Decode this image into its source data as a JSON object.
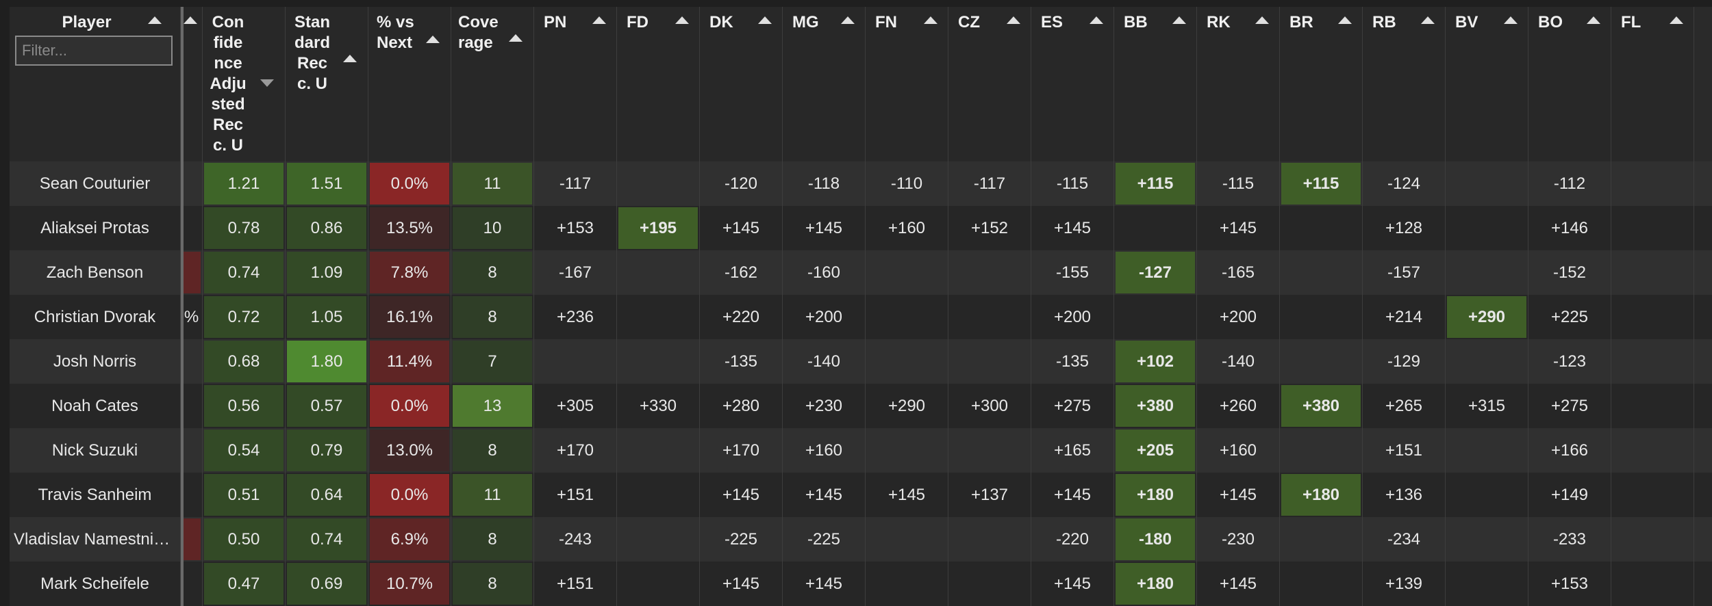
{
  "colors": {
    "best_odds": "#3f5e27",
    "coverage_high": "#4f7a2f",
    "coverage_mid": "#3b5428",
    "coverage_low": "#2f3e27",
    "red_strong": "#8a2626",
    "red_mid": "#5f2525",
    "red_low": "#3e2626",
    "green_strong": "#4f8a30",
    "green_mid": "#3e6528",
    "green_low": "#334a26"
  },
  "filter": {
    "placeholder": "Filter..."
  },
  "columns": [
    {
      "key": "player",
      "label": "Player",
      "sort": "up"
    },
    {
      "key": "edge",
      "label": "",
      "sort": "up"
    },
    {
      "key": "conf",
      "label": "Confidence Adjusted Recc. U",
      "sort": "down"
    },
    {
      "key": "std",
      "label": "Standard Recc. U",
      "sort": "up"
    },
    {
      "key": "pct",
      "label": "% vs Next",
      "sort": "up"
    },
    {
      "key": "cov",
      "label": "Coverage",
      "sort": "up"
    },
    {
      "key": "PN",
      "label": "PN",
      "sort": "up"
    },
    {
      "key": "FD",
      "label": "FD",
      "sort": "up"
    },
    {
      "key": "DK",
      "label": "DK",
      "sort": "up"
    },
    {
      "key": "MG",
      "label": "MG",
      "sort": "up"
    },
    {
      "key": "FN",
      "label": "FN",
      "sort": "up"
    },
    {
      "key": "CZ",
      "label": "CZ",
      "sort": "up"
    },
    {
      "key": "ES",
      "label": "ES",
      "sort": "up"
    },
    {
      "key": "BB",
      "label": "BB",
      "sort": "up"
    },
    {
      "key": "RK",
      "label": "RK",
      "sort": "up"
    },
    {
      "key": "BR",
      "label": "BR",
      "sort": "up"
    },
    {
      "key": "RB",
      "label": "RB",
      "sort": "up"
    },
    {
      "key": "BV",
      "label": "BV",
      "sort": "up"
    },
    {
      "key": "BO",
      "label": "BO",
      "sort": "up"
    },
    {
      "key": "FL",
      "label": "FL",
      "sort": "up"
    }
  ],
  "rows": [
    {
      "player": "Sean Couturier",
      "edge": "",
      "conf": "1.21",
      "std": "1.51",
      "pct": "0.0%",
      "cov": "11",
      "PN": "-117",
      "FD": "",
      "DK": "-120",
      "MG": "-118",
      "FN": "-110",
      "CZ": "-117",
      "ES": "-115",
      "BB": "+115",
      "RK": "-115",
      "BR": "+115",
      "RB": "-124",
      "BV": "",
      "BO": "-112",
      "FL": "",
      "best": [
        "BB",
        "BR"
      ],
      "conf_level": "mid",
      "std_level": "mid",
      "pct_level": "strong",
      "cov_level": "mid"
    },
    {
      "player": "Aliaksei Protas",
      "edge": "",
      "conf": "0.78",
      "std": "0.86",
      "pct": "13.5%",
      "cov": "10",
      "PN": "+153",
      "FD": "+195",
      "DK": "+145",
      "MG": "+145",
      "FN": "+160",
      "CZ": "+152",
      "ES": "+145",
      "BB": "",
      "RK": "+145",
      "BR": "",
      "RB": "+128",
      "BV": "",
      "BO": "+146",
      "FL": "",
      "best": [
        "FD"
      ],
      "conf_level": "low",
      "std_level": "low",
      "pct_level": "low",
      "cov_level": "low"
    },
    {
      "player": "Zach Benson",
      "edge": "",
      "conf": "0.74",
      "std": "1.09",
      "pct": "7.8%",
      "cov": "8",
      "PN": "-167",
      "FD": "",
      "DK": "-162",
      "MG": "-160",
      "FN": "",
      "CZ": "",
      "ES": "-155",
      "BB": "-127",
      "RK": "-165",
      "BR": "",
      "RB": "-157",
      "BV": "",
      "BO": "-152",
      "FL": "",
      "best": [
        "BB"
      ],
      "conf_level": "low",
      "std_level": "low",
      "pct_level": "mid",
      "cov_level": "low"
    },
    {
      "player": "Christian Dvorak",
      "edge": "%",
      "conf": "0.72",
      "std": "1.05",
      "pct": "16.1%",
      "cov": "8",
      "PN": "+236",
      "FD": "",
      "DK": "+220",
      "MG": "+200",
      "FN": "",
      "CZ": "",
      "ES": "+200",
      "BB": "",
      "RK": "+200",
      "BR": "",
      "RB": "+214",
      "BV": "+290",
      "BO": "+225",
      "FL": "",
      "best": [
        "BV"
      ],
      "conf_level": "low",
      "std_level": "low",
      "pct_level": "low",
      "cov_level": "low"
    },
    {
      "player": "Josh Norris",
      "edge": "",
      "conf": "0.68",
      "std": "1.80",
      "pct": "11.4%",
      "cov": "7",
      "PN": "",
      "FD": "",
      "DK": "-135",
      "MG": "-140",
      "FN": "",
      "CZ": "",
      "ES": "-135",
      "BB": "+102",
      "RK": "-140",
      "BR": "",
      "RB": "-129",
      "BV": "",
      "BO": "-123",
      "FL": "",
      "best": [
        "BB"
      ],
      "conf_level": "low",
      "std_level": "strong",
      "pct_level": "mid",
      "cov_level": "low"
    },
    {
      "player": "Noah Cates",
      "edge": "",
      "conf": "0.56",
      "std": "0.57",
      "pct": "0.0%",
      "cov": "13",
      "PN": "+305",
      "FD": "+330",
      "DK": "+280",
      "MG": "+230",
      "FN": "+290",
      "CZ": "+300",
      "ES": "+275",
      "BB": "+380",
      "RK": "+260",
      "BR": "+380",
      "RB": "+265",
      "BV": "+315",
      "BO": "+275",
      "FL": "",
      "best": [
        "BB",
        "BR"
      ],
      "conf_level": "low",
      "std_level": "low",
      "pct_level": "strong",
      "cov_level": "high"
    },
    {
      "player": "Nick Suzuki",
      "edge": "",
      "conf": "0.54",
      "std": "0.79",
      "pct": "13.0%",
      "cov": "8",
      "PN": "+170",
      "FD": "",
      "DK": "+170",
      "MG": "+160",
      "FN": "",
      "CZ": "",
      "ES": "+165",
      "BB": "+205",
      "RK": "+160",
      "BR": "",
      "RB": "+151",
      "BV": "",
      "BO": "+166",
      "FL": "",
      "best": [
        "BB"
      ],
      "conf_level": "low",
      "std_level": "low",
      "pct_level": "low",
      "cov_level": "low"
    },
    {
      "player": "Travis Sanheim",
      "edge": "",
      "conf": "0.51",
      "std": "0.64",
      "pct": "0.0%",
      "cov": "11",
      "PN": "+151",
      "FD": "",
      "DK": "+145",
      "MG": "+145",
      "FN": "+145",
      "CZ": "+137",
      "ES": "+145",
      "BB": "+180",
      "RK": "+145",
      "BR": "+180",
      "RB": "+136",
      "BV": "",
      "BO": "+149",
      "FL": "",
      "best": [
        "BB",
        "BR"
      ],
      "conf_level": "low",
      "std_level": "low",
      "pct_level": "strong",
      "cov_level": "mid"
    },
    {
      "player": "Vladislav Namestnikov",
      "edge": "",
      "conf": "0.50",
      "std": "0.74",
      "pct": "6.9%",
      "cov": "8",
      "PN": "-243",
      "FD": "",
      "DK": "-225",
      "MG": "-225",
      "FN": "",
      "CZ": "",
      "ES": "-220",
      "BB": "-180",
      "RK": "-230",
      "BR": "",
      "RB": "-234",
      "BV": "",
      "BO": "-233",
      "FL": "",
      "best": [
        "BB"
      ],
      "conf_level": "low",
      "std_level": "low",
      "pct_level": "mid",
      "cov_level": "low"
    },
    {
      "player": "Mark Scheifele",
      "edge": "",
      "conf": "0.47",
      "std": "0.69",
      "pct": "10.7%",
      "cov": "8",
      "PN": "+151",
      "FD": "",
      "DK": "+145",
      "MG": "+145",
      "FN": "",
      "CZ": "",
      "ES": "+145",
      "BB": "+180",
      "RK": "+145",
      "BR": "",
      "RB": "+139",
      "BV": "",
      "BO": "+153",
      "FL": "",
      "best": [
        "BB"
      ],
      "conf_level": "low",
      "std_level": "low",
      "pct_level": "mid",
      "cov_level": "low"
    }
  ]
}
